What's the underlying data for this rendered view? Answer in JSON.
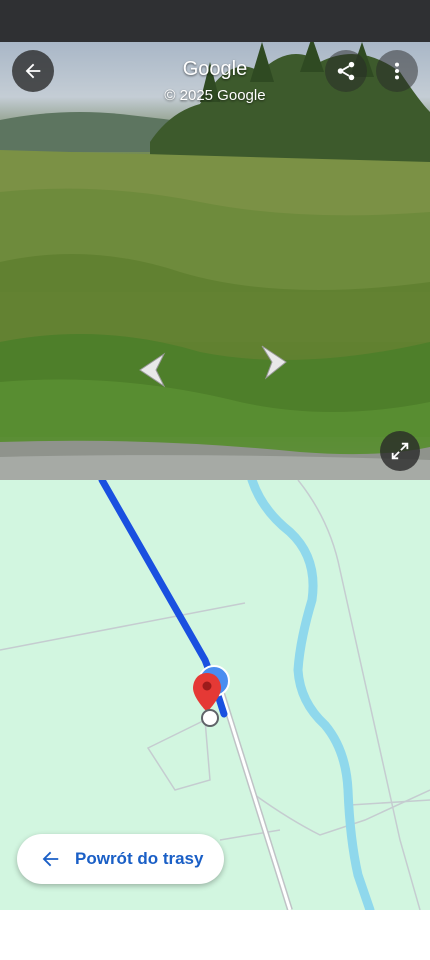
{
  "header": {
    "title": "Google",
    "copyright": "© 2025 Google"
  },
  "icons": {
    "back": "arrow-left-icon",
    "share": "share-icon",
    "more": "more-vertical-icon",
    "expand": "expand-icon",
    "pano_left": "chevron-left-icon",
    "pano_right": "chevron-right-icon",
    "pin": "red-location-pin-icon"
  },
  "colors": {
    "route": "#1a50e0",
    "river": "#8fd8ec",
    "map_background": "#d2f6e0",
    "pin": "#e53935",
    "accent": "#1a5fc6"
  },
  "route_button": {
    "label": "Powrót do trasy"
  }
}
